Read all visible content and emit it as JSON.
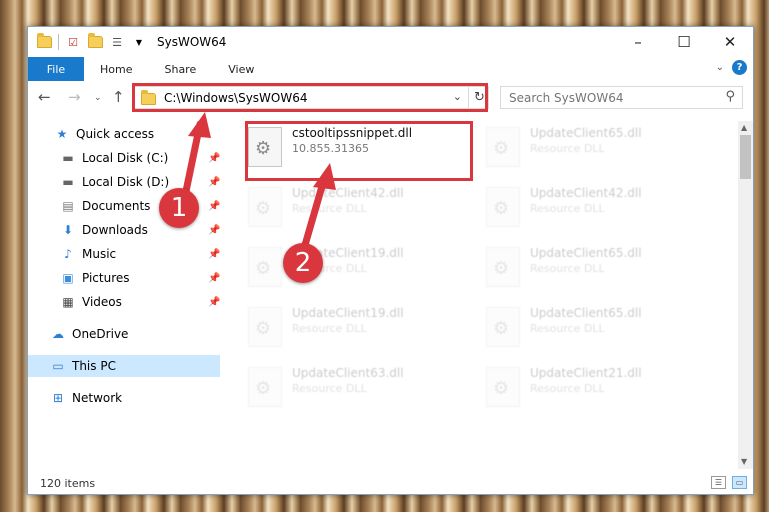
{
  "window": {
    "title": "SysWOW64",
    "controls": {
      "minimize": "–",
      "maximize": "☐",
      "close": "✕"
    }
  },
  "ribbon": {
    "tabs": [
      "File",
      "Home",
      "Share",
      "View"
    ],
    "help": "?"
  },
  "nav": {
    "address": "C:\\Windows\\SysWOW64",
    "search_placeholder": "Search SysWOW64"
  },
  "sidebar": {
    "items": [
      {
        "label": "Quick access",
        "icon": "star-icon"
      },
      {
        "label": "Local Disk (C:)",
        "icon": "drive-icon",
        "pinned": true
      },
      {
        "label": "Local Disk (D:)",
        "icon": "drive-icon",
        "pinned": true
      },
      {
        "label": "Documents",
        "icon": "documents-icon",
        "pinned": true
      },
      {
        "label": "Downloads",
        "icon": "download-icon",
        "pinned": true
      },
      {
        "label": "Music",
        "icon": "music-icon",
        "pinned": true
      },
      {
        "label": "Pictures",
        "icon": "pictures-icon",
        "pinned": true
      },
      {
        "label": "Videos",
        "icon": "videos-icon",
        "pinned": true
      },
      {
        "label": "OneDrive",
        "icon": "cloud-icon"
      },
      {
        "label": "This PC",
        "icon": "monitor-icon",
        "selected": true
      },
      {
        "label": "Network",
        "icon": "network-icon"
      }
    ]
  },
  "files": {
    "highlighted": {
      "name": "cstooltipssnippet.dll",
      "version": "10.855.31365"
    },
    "faded": [
      {
        "name": "UpdateClient65.dll",
        "type": "Resource DLL"
      },
      {
        "name": "UpdateClient42.dll",
        "type": "Resource DLL"
      },
      {
        "name": "UpdateClient42.dll",
        "type": "Resource DLL"
      },
      {
        "name": "UpdateClient19.dll",
        "type": "Resource DLL"
      },
      {
        "name": "UpdateClient65.dll",
        "type": "Resource DLL"
      },
      {
        "name": "UpdateClient19.dll",
        "type": "Resource DLL"
      },
      {
        "name": "UpdateClient65.dll",
        "type": "Resource DLL"
      },
      {
        "name": "UpdateClient63.dll",
        "type": "Resource DLL"
      },
      {
        "name": "UpdateClient21.dll",
        "type": "Resource DLL"
      }
    ]
  },
  "status": {
    "count": "120 items"
  },
  "callouts": [
    "1",
    "2"
  ],
  "colors": {
    "accent": "#1979ca",
    "callout_red": "#d9363e",
    "selection": "#cce8ff"
  }
}
